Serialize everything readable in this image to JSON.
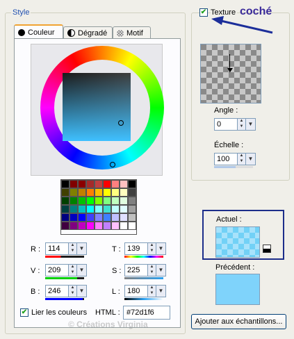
{
  "style_group": {
    "legend": "Style"
  },
  "tabs": [
    {
      "label": "Couleur",
      "icon": "filled-circle-icon",
      "active": true
    },
    {
      "label": "Dégradé",
      "icon": "half-circle-icon",
      "active": false
    },
    {
      "label": "Motif",
      "icon": "pattern-circle-icon",
      "active": false
    }
  ],
  "rgb": {
    "r_label": "R :",
    "r_value": "114",
    "v_label": "V :",
    "v_value": "209",
    "b_label": "B :",
    "b_value": "246"
  },
  "tsl": {
    "t_label": "T :",
    "t_value": "139",
    "s_label": "S :",
    "s_value": "225",
    "l_label": "L :",
    "l_value": "180"
  },
  "link_colors": {
    "label": "Lier les couleurs",
    "checked": true
  },
  "html": {
    "label": "HTML :",
    "value": "#72d1f6"
  },
  "texture": {
    "label": "Texture",
    "checked": true,
    "annotation": "coché"
  },
  "angle": {
    "label": "Angle :",
    "value": "0"
  },
  "echelle": {
    "label": "Échelle :",
    "value": "100"
  },
  "actuel": {
    "label": "Actuel :",
    "color": "#72d1f6"
  },
  "precedent": {
    "label": "Précédent :",
    "color": "#7fd3fb"
  },
  "add_button": {
    "label": "Ajouter aux échantillons..."
  },
  "watermark": "© Créations Virginia",
  "palette": [
    [
      "#000000",
      "#800000",
      "#8b0000",
      "#a52a2a",
      "#c04040",
      "#ff0000",
      "#ff8080",
      "#ffc0c0",
      "#000000"
    ],
    [
      "#404000",
      "#808000",
      "#c08000",
      "#ff8000",
      "#ffc000",
      "#ffff00",
      "#ffff80",
      "#ffffc0",
      "#404040"
    ],
    [
      "#004000",
      "#008000",
      "#00c000",
      "#00ff00",
      "#80ff00",
      "#80ff80",
      "#c0ffc0",
      "#e0ffe0",
      "#808080"
    ],
    [
      "#004040",
      "#008080",
      "#00c0c0",
      "#00ffff",
      "#80ffff",
      "#40e0d0",
      "#c0ffff",
      "#e0ffff",
      "#a0a0a0"
    ],
    [
      "#000080",
      "#0000c0",
      "#0000ff",
      "#4040ff",
      "#8080ff",
      "#4080ff",
      "#c0c0ff",
      "#e0e0ff",
      "#c0c0c0"
    ],
    [
      "#400040",
      "#800080",
      "#c000c0",
      "#ff00ff",
      "#ff80ff",
      "#c080ff",
      "#ffc0ff",
      "#ffffff",
      "#ffffff"
    ]
  ]
}
